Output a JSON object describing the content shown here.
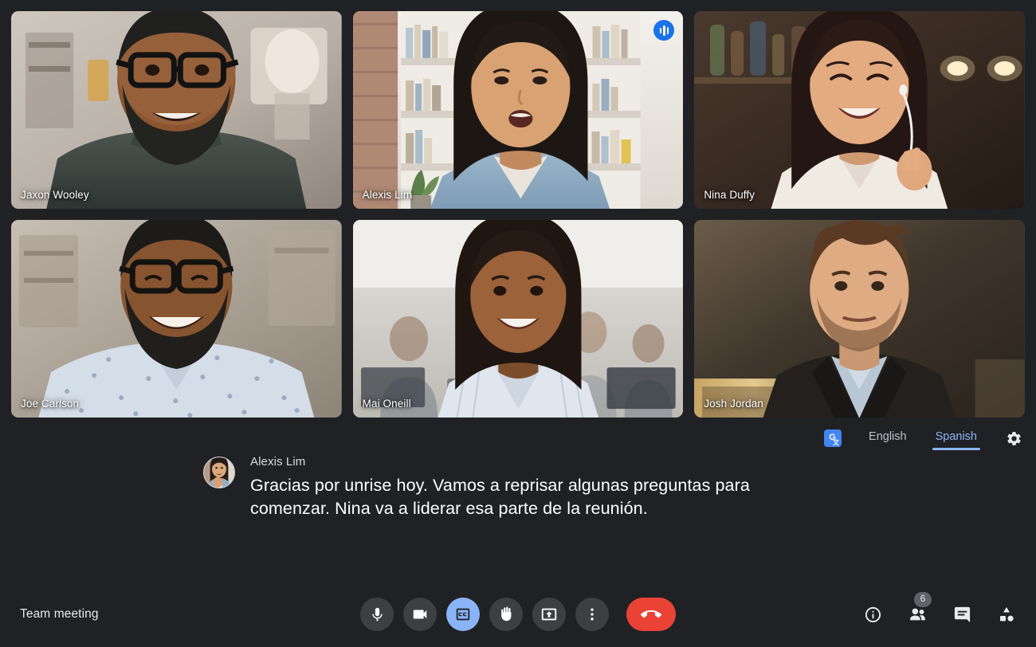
{
  "meeting": {
    "title": "Team meeting"
  },
  "participants": [
    {
      "name": "Jaxon Wooley",
      "speaking": false
    },
    {
      "name": "Alexis Lim",
      "speaking": true
    },
    {
      "name": "Nina Duffy",
      "speaking": false
    },
    {
      "name": "Joe Carlson",
      "speaking": false
    },
    {
      "name": "Mai Oneill",
      "speaking": false
    },
    {
      "name": "Josh Jordan",
      "speaking": false
    }
  ],
  "captions": {
    "translate_icon": "translate-icon",
    "languages": [
      {
        "label": "English",
        "selected": false
      },
      {
        "label": "Spanish",
        "selected": true
      }
    ],
    "settings_icon": "gear-icon",
    "speaker": "Alexis Lim",
    "text": "Gracias por unrise hoy. Vamos a reprisar algunas preguntas para comenzar. Nina va a liderar esa parte de la reunión."
  },
  "toolbar": {
    "controls": [
      {
        "name": "microphone-button",
        "icon": "microphone-icon",
        "active": false
      },
      {
        "name": "camera-button",
        "icon": "video-camera-icon",
        "active": false
      },
      {
        "name": "captions-button",
        "icon": "closed-captions-icon",
        "active": true
      },
      {
        "name": "raise-hand-button",
        "icon": "raised-hand-icon",
        "active": false
      },
      {
        "name": "present-screen-button",
        "icon": "present-screen-icon",
        "active": false
      },
      {
        "name": "more-options-button",
        "icon": "more-vertical-icon",
        "active": false
      }
    ],
    "end_call": {
      "name": "end-call-button",
      "icon": "phone-hangup-icon",
      "color": "#ea4335"
    }
  },
  "right_controls": [
    {
      "name": "meeting-details-button",
      "icon": "info-icon",
      "badge": null
    },
    {
      "name": "participants-button",
      "icon": "people-icon",
      "badge": "6"
    },
    {
      "name": "chat-button",
      "icon": "chat-bubble-icon",
      "badge": null
    },
    {
      "name": "activities-button",
      "icon": "activities-icon",
      "badge": null
    }
  ],
  "colors": {
    "background": "#202124",
    "active_speaker_border": "#4285f4",
    "accent": "#8ab4f8",
    "end_call": "#ea4335",
    "control_bg": "#3c4043"
  }
}
